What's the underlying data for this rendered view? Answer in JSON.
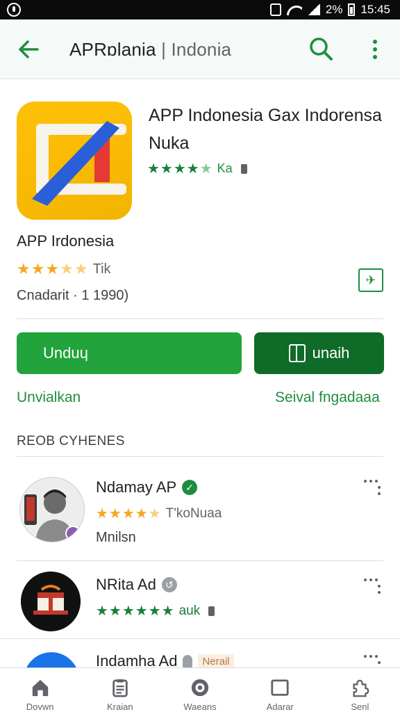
{
  "status_bar": {
    "battery": "2%",
    "time": "15:45"
  },
  "app_bar": {
    "title_main": "APRɒlania",
    "title_sep": "|",
    "title_sub": "Indonia"
  },
  "hero": {
    "title": "APP Indonesia Gax Indorensa Nuka",
    "rating_text": "Ka"
  },
  "app": {
    "name": "APP Irdonesia",
    "rating_text": "Tik",
    "meta": "Cnadarit · 1 1990)"
  },
  "actions": {
    "install_label": "Unduɥ",
    "open_label": "unaih",
    "link_left": "Unvialkan",
    "link_right": "Seival fngadaaa"
  },
  "section": {
    "title": "REOB CYHENES"
  },
  "items": [
    {
      "title": "Ndamay AP",
      "verified": "✓",
      "rating_text": "T'koNuaa",
      "sub": "Mnilsn"
    },
    {
      "title": "NRita Ad",
      "verified": "↺",
      "rating_text": "auk",
      "sub": ""
    },
    {
      "title": "Indamha Ad",
      "tag": "Nerail"
    }
  ],
  "bottom_nav": [
    {
      "label": "Dovwn",
      "icon": "home-icon"
    },
    {
      "label": "Kraian",
      "icon": "clipboard-icon"
    },
    {
      "label": "Waeans",
      "icon": "circle-target-icon"
    },
    {
      "label": "Adarar",
      "icon": "window-icon"
    },
    {
      "label": "Senl",
      "icon": "puzzle-icon"
    }
  ],
  "colors": {
    "accent": "#1e8e3e",
    "install": "#22a33c",
    "open": "#0f6b28",
    "icon_bg": "#ffc107"
  }
}
